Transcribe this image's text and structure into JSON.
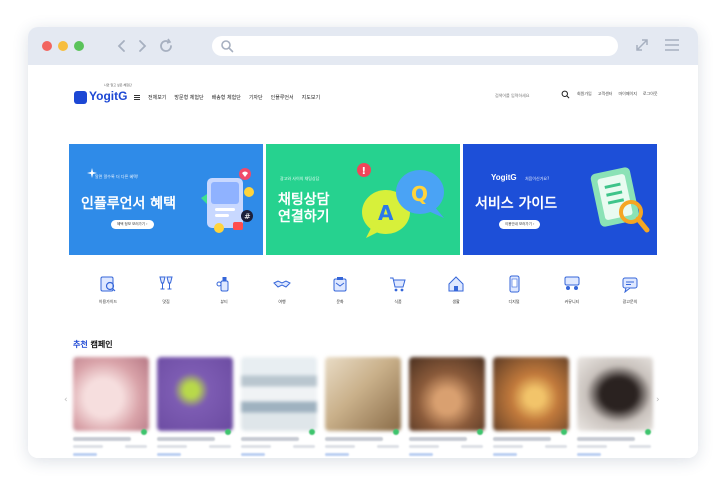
{
  "colors": {
    "brand": "#1c47d4",
    "banner1": "#2f8be8",
    "banner2": "#26d28f",
    "banner3": "#1d4fd8",
    "badge_green": "#3ec46d"
  },
  "logo": {
    "word": "YogitG",
    "tagline": "나만 알고 싶은 체험단"
  },
  "gnb": {
    "items": [
      "전체보기",
      "방문형 체험단",
      "배송형 체험단",
      "기자단",
      "인플루언서",
      "지도보기"
    ]
  },
  "search": {
    "placeholder": "검색어를 입력하세요"
  },
  "util": [
    "회원가입",
    "고객센터",
    "마이페이지",
    "로그아웃"
  ],
  "banners": [
    {
      "sub": "알면 알수록 더 다른 혜택!",
      "title": "인플루언서 혜택",
      "button": "혜택 정보 보러가기 ›"
    },
    {
      "sub": "광고와 사이의 채팅상담",
      "title": "채팅상담\n연결하기"
    },
    {
      "brand": "YogitG",
      "sub": "처음이신가요?",
      "title": "서비스 가이드",
      "button": "이용안내 보러가기 ›"
    }
  ],
  "categories": [
    {
      "label": "이용가이드",
      "icon": "guide-icon"
    },
    {
      "label": "맛집",
      "icon": "cheers-icon"
    },
    {
      "label": "뷰티",
      "icon": "beauty-icon"
    },
    {
      "label": "여행",
      "icon": "handshake-icon"
    },
    {
      "label": "문화",
      "icon": "ticket-icon"
    },
    {
      "label": "식품",
      "icon": "cart-icon"
    },
    {
      "label": "생활",
      "icon": "home-icon"
    },
    {
      "label": "디지털",
      "icon": "phone-icon"
    },
    {
      "label": "커뮤니티",
      "icon": "community-icon"
    },
    {
      "label": "광고문의",
      "icon": "ad-inquiry-icon"
    }
  ],
  "section": {
    "title_highlight": "추천",
    "title_rest": "캠페인"
  },
  "campaign_count": 7
}
